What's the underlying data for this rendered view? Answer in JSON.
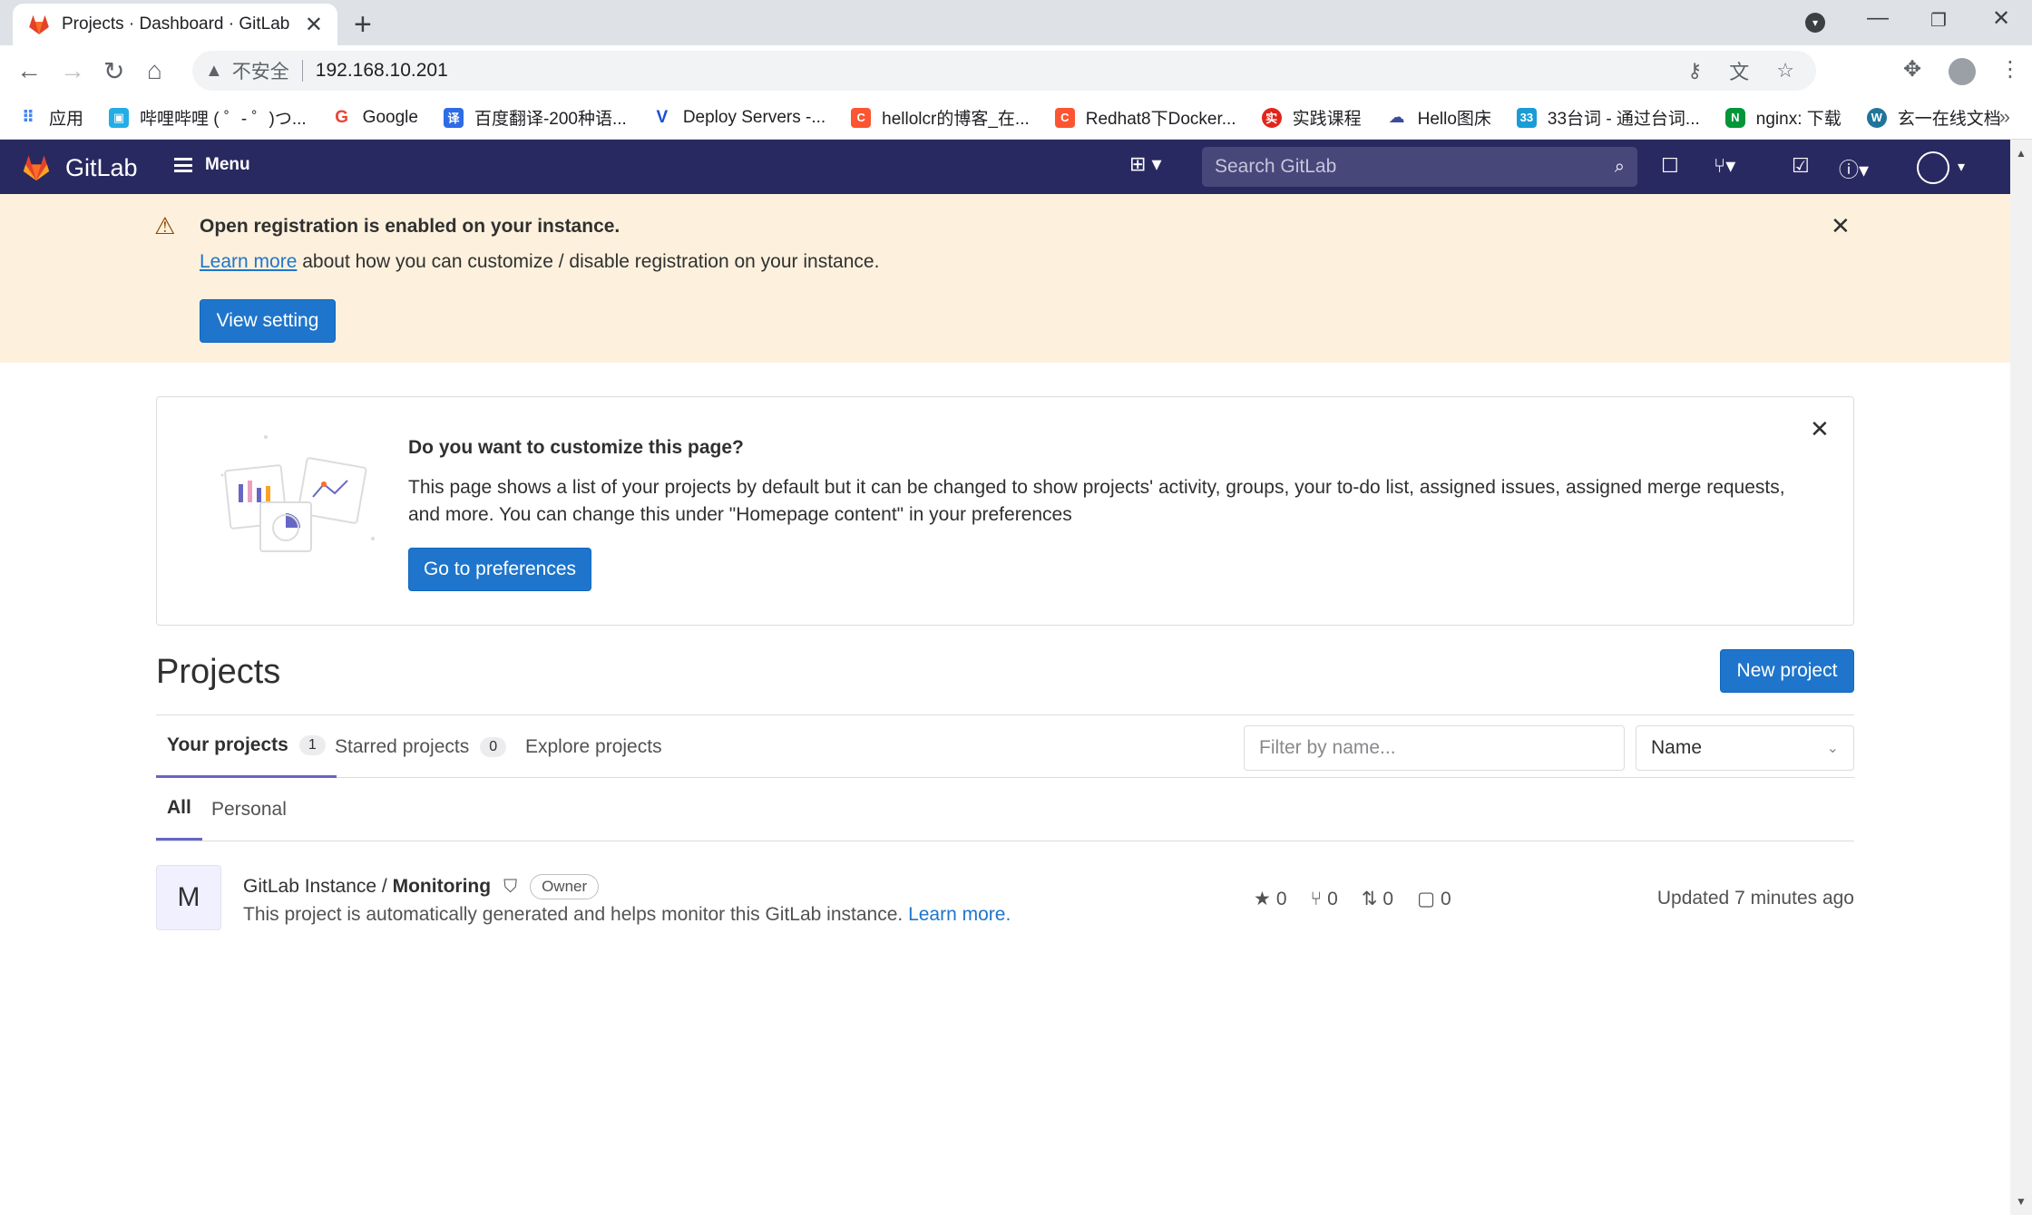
{
  "browser": {
    "tab_title": "Projects · Dashboard · GitLab",
    "insecure_label": "不安全",
    "url": "192.168.10.201",
    "bookmarks": [
      {
        "label": "应用",
        "color": "#4285f4",
        "icon": "apps-grid-icon"
      },
      {
        "label": "哔哩哔哩 ( ゜- ゜)つ...",
        "color": "#23ade5",
        "icon": "bilibili-icon"
      },
      {
        "label": "Google",
        "color": "#ea4335",
        "icon": "google-icon"
      },
      {
        "label": "百度翻译-200种语...",
        "color": "#2e6be6",
        "icon": "baidu-translate-icon"
      },
      {
        "label": "Deploy Servers -...",
        "color": "#1a4fd6",
        "icon": "vuetify-icon"
      },
      {
        "label": "hellolcr的博客_在...",
        "color": "#fc5531",
        "icon": "csdn-icon"
      },
      {
        "label": "Redhat8下Docker...",
        "color": "#fc5531",
        "icon": "csdn-icon"
      },
      {
        "label": "实践课程",
        "color": "#e1251b",
        "icon": "course-icon"
      },
      {
        "label": "Hello图床",
        "color": "#3b4b9c",
        "icon": "cloud-icon"
      },
      {
        "label": "33台词 - 通过台词...",
        "color": "#1a9cd6",
        "icon": "33-icon"
      },
      {
        "label": "nginx: 下载",
        "color": "#009639",
        "icon": "nginx-icon"
      },
      {
        "label": "玄一在线文档",
        "color": "#21759b",
        "icon": "wordpress-icon"
      }
    ]
  },
  "gitlab": {
    "brand": "GitLab",
    "menu_label": "Menu",
    "search_placeholder": "Search GitLab"
  },
  "reg_alert": {
    "title": "Open registration is enabled on your instance.",
    "link": "Learn more",
    "text": " about how you can customize / disable registration on your instance.",
    "button": "View setting"
  },
  "customize": {
    "title": "Do you want to customize this page?",
    "body": "This page shows a list of your projects by default but it can be changed to show projects' activity, groups, your to-do list, assigned issues, assigned merge requests, and more. You can change this under \"Homepage content\" in your preferences",
    "button": "Go to preferences"
  },
  "projects": {
    "title": "Projects",
    "new_button": "New project",
    "tabs": [
      {
        "label": "Your projects",
        "count": "1"
      },
      {
        "label": "Starred projects",
        "count": "0"
      },
      {
        "label": "Explore projects"
      }
    ],
    "filter_placeholder": "Filter by name...",
    "sort_value": "Name",
    "subtabs": [
      "All",
      "Personal"
    ],
    "items": [
      {
        "avatar_letter": "M",
        "namespace": "GitLab Instance / ",
        "name": "Monitoring",
        "role": "Owner",
        "description": "This project is automatically generated and helps monitor this GitLab instance.",
        "desc_link": "Learn more.",
        "stars": "0",
        "forks": "0",
        "merge_requests": "0",
        "issues": "0",
        "updated": "Updated 7 minutes ago"
      }
    ]
  }
}
